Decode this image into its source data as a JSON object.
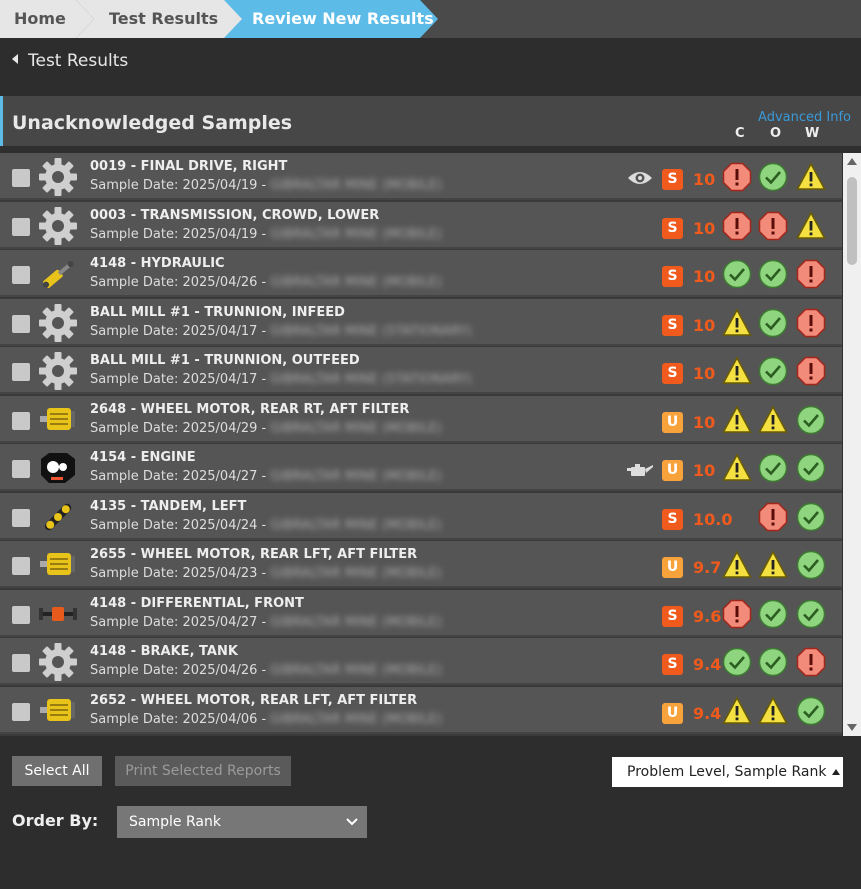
{
  "breadcrumb": {
    "home": "Home",
    "test_results": "Test Results",
    "current": "Review New Results"
  },
  "back_link": "Test Results",
  "section": {
    "title": "Unacknowledged Samples",
    "advanced_info": "Advanced Info",
    "col_c": "C",
    "col_o": "O",
    "col_w": "W"
  },
  "rows": [
    {
      "title": "0019 - FINAL DRIVE, RIGHT",
      "date": "Sample Date: 2025/04/19 -",
      "site": "GIBRALTAR MINE (MOBILE)",
      "icon": "gear-icon",
      "aux": "eye-icon",
      "badge": "S",
      "rank": "10",
      "c": "critical",
      "o": "ok",
      "w": "warning"
    },
    {
      "title": "0003 - TRANSMISSION, CROWD, LOWER",
      "date": "Sample Date: 2025/04/19 -",
      "site": "GIBRALTAR MINE (MOBILE)",
      "icon": "gear-icon",
      "aux": "",
      "badge": "S",
      "rank": "10",
      "c": "critical",
      "o": "critical",
      "w": "warning"
    },
    {
      "title": "4148 - HYDRAULIC",
      "date": "Sample Date: 2025/04/26 -",
      "site": "GIBRALTAR MINE (MOBILE)",
      "icon": "hydraulic-cylinder-icon",
      "aux": "",
      "badge": "S",
      "rank": "10",
      "c": "ok",
      "o": "ok",
      "w": "critical"
    },
    {
      "title": "BALL MILL #1 - TRUNNION, INFEED",
      "date": "Sample Date: 2025/04/17 -",
      "site": "GIBRALTAR MINE (STATIONARY)",
      "icon": "gear-icon",
      "aux": "",
      "badge": "S",
      "rank": "10",
      "c": "warning",
      "o": "ok",
      "w": "critical"
    },
    {
      "title": "BALL MILL #1 - TRUNNION, OUTFEED",
      "date": "Sample Date: 2025/04/17 -",
      "site": "GIBRALTAR MINE (STATIONARY)",
      "icon": "gear-icon",
      "aux": "",
      "badge": "S",
      "rank": "10",
      "c": "warning",
      "o": "ok",
      "w": "critical"
    },
    {
      "title": "2648 - WHEEL MOTOR, REAR RT, AFT FILTER",
      "date": "Sample Date: 2025/04/29 -",
      "site": "GIBRALTAR MINE (MOBILE)",
      "icon": "wheel-motor-icon",
      "aux": "",
      "badge": "U",
      "rank": "10",
      "c": "warning",
      "o": "warning",
      "w": "ok"
    },
    {
      "title": "4154 - ENGINE",
      "date": "Sample Date: 2025/04/27 -",
      "site": "GIBRALTAR MINE (MOBILE)",
      "icon": "engine-icon",
      "aux": "oil-can-icon",
      "badge": "U",
      "rank": "10",
      "c": "warning",
      "o": "ok",
      "w": "ok"
    },
    {
      "title": "4135 - TANDEM, LEFT",
      "date": "Sample Date: 2025/04/24 -",
      "site": "GIBRALTAR MINE (MOBILE)",
      "icon": "tandem-icon",
      "aux": "",
      "badge": "S",
      "rank": "10.0",
      "c": "none",
      "o": "critical",
      "w": "ok"
    },
    {
      "title": "2655 - WHEEL MOTOR, REAR LFT, AFT FILTER",
      "date": "Sample Date: 2025/04/23 -",
      "site": "GIBRALTAR MINE (MOBILE)",
      "icon": "wheel-motor-icon",
      "aux": "",
      "badge": "U",
      "rank": "9.7",
      "c": "warning",
      "o": "warning",
      "w": "ok"
    },
    {
      "title": "4148 - DIFFERENTIAL, FRONT",
      "date": "Sample Date: 2025/04/27 -",
      "site": "GIBRALTAR MINE (MOBILE)",
      "icon": "differential-icon",
      "aux": "",
      "badge": "S",
      "rank": "9.6",
      "c": "critical",
      "o": "ok",
      "w": "ok"
    },
    {
      "title": "4148 - BRAKE, TANK",
      "date": "Sample Date: 2025/04/26 -",
      "site": "GIBRALTAR MINE (MOBILE)",
      "icon": "gear-icon",
      "aux": "",
      "badge": "S",
      "rank": "9.4",
      "c": "ok",
      "o": "ok",
      "w": "critical"
    },
    {
      "title": "2652 - WHEEL MOTOR, REAR LFT, AFT FILTER",
      "date": "Sample Date: 2025/04/06 -",
      "site": "GIBRALTAR MINE (MOBILE)",
      "icon": "wheel-motor-icon",
      "aux": "",
      "badge": "U",
      "rank": "9.4",
      "c": "warning",
      "o": "warning",
      "w": "ok"
    }
  ],
  "footer": {
    "select_all": "Select All",
    "print_selected": "Print Selected Reports",
    "sort_label": "Problem Level, Sample Rank",
    "order_by_label": "Order By:",
    "order_by_value": "Sample Rank"
  },
  "colors": {
    "accent": "#5dbbe8",
    "badge_s": "#f05a1c",
    "badge_u": "#f7a23a",
    "ok": "#8fd47e",
    "warning": "#f5e042",
    "critical": "#f28b7a"
  }
}
